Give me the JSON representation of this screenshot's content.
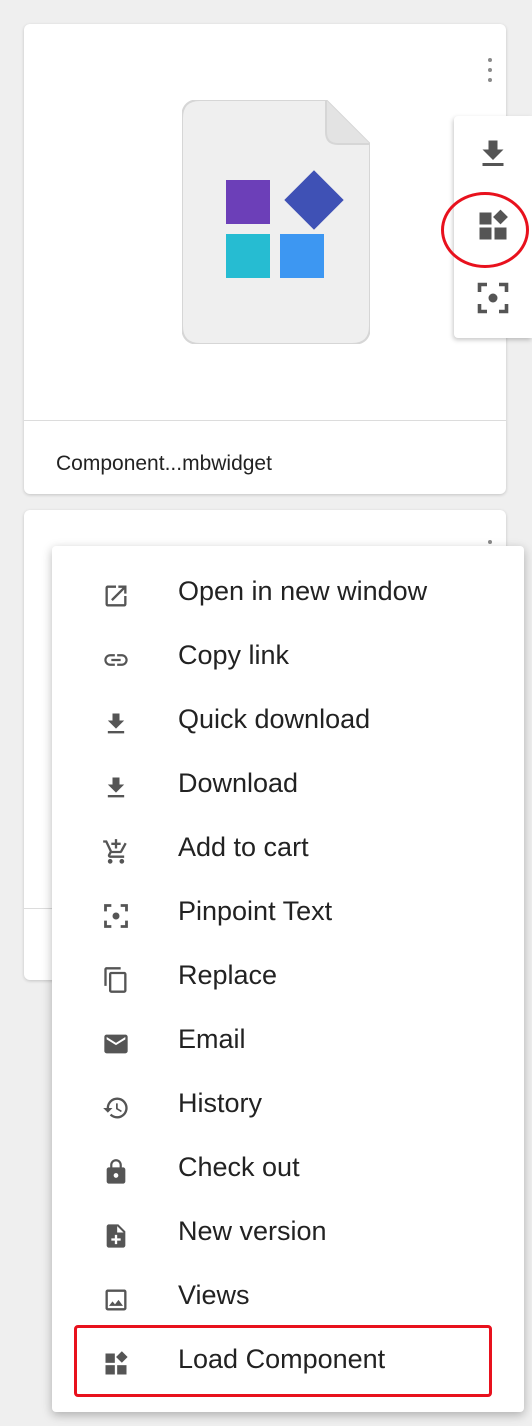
{
  "cards": [
    {
      "name": "Component...mbwidget",
      "file_icon": "component-file-icon",
      "menu_icon": "more-vert-icon",
      "actions": [
        {
          "icon": "download-icon"
        },
        {
          "icon": "load-component-icon"
        },
        {
          "icon": "pinpoint-text-icon"
        }
      ]
    },
    {
      "menu_icon": "more-vert-icon"
    }
  ],
  "context_menu": {
    "items": [
      {
        "label": "Open in new window",
        "icon": "open-in-new-icon"
      },
      {
        "label": "Copy link",
        "icon": "link-icon"
      },
      {
        "label": "Quick download",
        "icon": "download-icon"
      },
      {
        "label": "Download",
        "icon": "download-icon"
      },
      {
        "label": "Add to cart",
        "icon": "add-to-cart-icon"
      },
      {
        "label": "Pinpoint Text",
        "icon": "pinpoint-text-icon"
      },
      {
        "label": "Replace",
        "icon": "replace-icon"
      },
      {
        "label": "Email",
        "icon": "email-icon"
      },
      {
        "label": "History",
        "icon": "history-icon"
      },
      {
        "label": "Check out",
        "icon": "lock-icon"
      },
      {
        "label": "New version",
        "icon": "new-version-icon"
      },
      {
        "label": "Views",
        "icon": "image-icon"
      },
      {
        "label": "Load Component",
        "icon": "load-component-icon"
      }
    ]
  },
  "colors": {
    "highlight": "#e8111d",
    "icon_gray": "#555555",
    "component_purple": "#6c3fb8",
    "component_indigo": "#3f51b5",
    "component_cyan": "#26bcd2",
    "component_blue": "#3d97f2"
  }
}
